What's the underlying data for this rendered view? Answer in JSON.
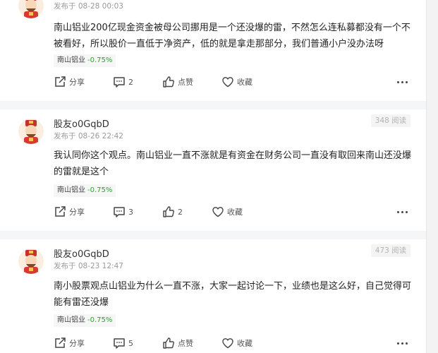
{
  "posts": [
    {
      "username": "",
      "meta": "发布于 08-28 00:03",
      "reads": "",
      "content": "南山铝业200亿现金资金被母公司挪用是一个还没爆的雷，不然怎么连私募都没有一个不被看好，所以股价一直低于净资产，低的就是拿走那部分，我们普通小户没办法呀",
      "stock": {
        "name": "南山铝业",
        "change": "-0.75%"
      },
      "actions": {
        "share": "分享",
        "comments": "2",
        "like": "点赞",
        "fav": "收藏"
      }
    },
    {
      "username": "股友o0GqbD",
      "meta": "发布于 08-26 22:42",
      "reads": "348 阅读",
      "content": "我认同你这个观点。南山铝业一直不涨就是有资金在财务公司一直没有取回来南山还没爆的雷就是这个",
      "stock": {
        "name": "南山铝业",
        "change": "-0.75%"
      },
      "actions": {
        "share": "分享",
        "comments": "3",
        "like": "2",
        "fav": "收藏"
      }
    },
    {
      "username": "股友o0GqbD",
      "meta": "发布于 08-23 12:47",
      "reads": "473 阅读",
      "content": "南小股票观点山铝业为什么一直不涨，大家一起讨论一下，业绩也是这么好，自己觉得可能有雷还没爆",
      "stock": {
        "name": "南山铝业",
        "change": "-0.75%"
      },
      "actions": {
        "share": "分享",
        "comments": "5",
        "like": "点赞",
        "fav": "收藏"
      }
    }
  ],
  "colors": {
    "stock_change": "#2aa52a",
    "separator": "#f5f6f7"
  },
  "icons": {
    "share": "share-icon",
    "comment": "comment-icon",
    "like": "thumbs-up-icon",
    "fav": "heart-icon",
    "more": "more-dots-icon",
    "avatar": "god-of-wealth-avatar"
  }
}
